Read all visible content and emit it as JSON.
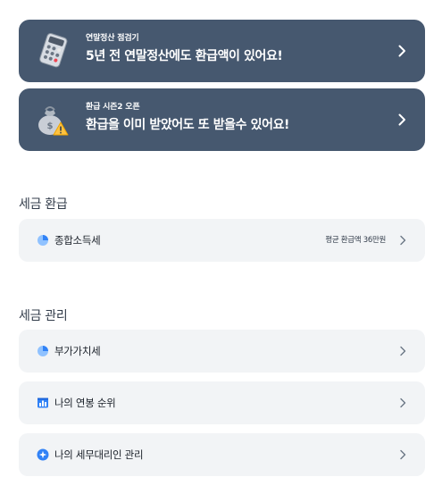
{
  "banners": [
    {
      "eyebrow": "연말정산 점검기",
      "title": "5년 전 연말정산에도 환급액이 있어요!",
      "icon": "calculator-icon"
    },
    {
      "eyebrow": "환급 시즌2 오픈",
      "title": "환급을 이미 받았어도 또 받을수 있어요!",
      "icon": "money-bag-warning-icon"
    }
  ],
  "sections": [
    {
      "title": "세금 환급",
      "items": [
        {
          "label": "종합소득세",
          "meta": "평균 환급액 36만원",
          "icon": "pie-chart-icon"
        }
      ]
    },
    {
      "title": "세금 관리",
      "items": [
        {
          "label": "부가가치세",
          "icon": "pie-chart-icon"
        },
        {
          "label": "나의 연봉 순위",
          "icon": "ranking-chart-icon"
        },
        {
          "label": "나의 세무대리인 관리",
          "icon": "star-badge-icon"
        }
      ]
    }
  ],
  "colors": {
    "banner_bg": "#46586f",
    "row_bg": "#f2f4f6",
    "accent_blue": "#3182f6"
  }
}
